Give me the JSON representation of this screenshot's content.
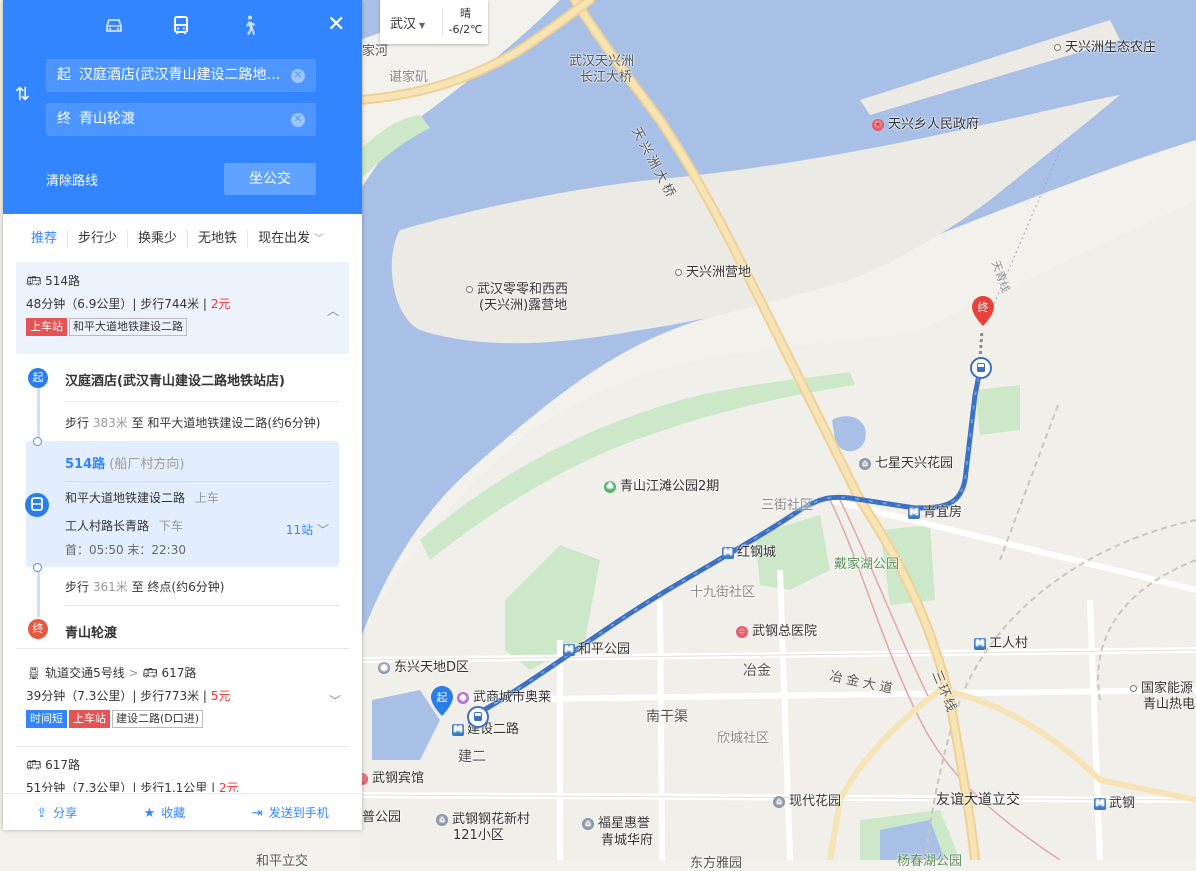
{
  "map": {
    "labels": {
      "jiahe": "家河",
      "chenjiaji": "谌家矶",
      "bridge1_l1": "武汉天兴洲",
      "bridge1_l2": "长江大桥",
      "txz_ecofarm": "天兴洲生态农庄",
      "txz_gov": "天兴乡人民政府",
      "txz_bridge": "天兴洲大桥",
      "camp1_l1": "武汉零零和西西",
      "camp1_l2": "(天兴洲)露营地",
      "txz_camp": "天兴洲营地",
      "ferry_line": "天青线",
      "qixing": "七星天兴花园",
      "qingshan_park": "青山江滩公园2期",
      "sanjieshe": "三街社区",
      "qingyifang": "青宜房",
      "hongganggcheng": "红钢城",
      "daijiahu": "戴家湖公园",
      "shijiujie": "十九街社区",
      "wugang_hosp": "武钢总医院",
      "heping_park": "和平公园",
      "gongrencun": "工人村",
      "dongxing": "东兴天地D区",
      "yejin": "冶金",
      "yejin_rd": "冶金大道",
      "ring3": "三环线",
      "outlets": "武商城市奥莱",
      "jianshe2rd": "建设二路",
      "jian2": "建二",
      "nanganqu": "南干渠",
      "xincheng": "欣城社区",
      "guojia1": "国家能源",
      "guojia2": "青山热电",
      "wugang_hotel": "武钢宾馆",
      "puyuan": "普公园",
      "wugang_hx1": "武钢钢花新村",
      "wugang_hx2": "121小区",
      "fuxing1": "福星惠誉",
      "fuxing2": "青城华府",
      "xiandai": "现代花园",
      "youyi": "友谊大道立交",
      "wugang_st": "武钢",
      "hepinglijiao": "和平立交",
      "donghuan": "东方雅园",
      "yangchun": "杨春湖公园"
    },
    "start_marker": "起",
    "end_marker": "终"
  },
  "weather": {
    "city": "武汉",
    "condition": "晴",
    "temp": "-6/2℃"
  },
  "panel": {
    "modes": [
      "car-icon",
      "bus-icon",
      "walk-icon"
    ],
    "close": "✕",
    "start_tag": "起",
    "start_value": "汉庭酒店(武汉青山建设二路地铁站店)",
    "end_tag": "终",
    "end_value": "青山轮渡",
    "clear": "清除路线",
    "search_button": "坐公交",
    "tabs": [
      "推荐",
      "步行少",
      "换乘少",
      "无地铁",
      "现在出发"
    ],
    "route1": {
      "name": "514路",
      "duration": "48分钟（6.9公里）| 步行744米 |",
      "price": "2元",
      "board_tag": "上车站",
      "board_stop": "和平大道地铁建设二路"
    },
    "steps": {
      "start_name": "汉庭酒店(武汉青山建设二路地铁站店)",
      "walk1_pre": "步行",
      "walk1_dist": "383米",
      "walk1_post": "至 和平大道地铁建设二路(约6分钟)",
      "bus_line": "514路",
      "bus_dir": "(船厂村方向)",
      "board_stop": "和平大道地铁建设二路",
      "board_label": "上车",
      "alight_stop": "工人村路长青路",
      "alight_label": "下车",
      "times": "首：05:50  末：22:30",
      "stops": "11站",
      "walk2_pre": "步行",
      "walk2_dist": "361米",
      "walk2_post": "至 终点(约6分钟)",
      "end_name": "青山轮渡"
    },
    "route2": {
      "line1": "轨道交通5号线",
      "line2": "617路",
      "duration": "39分钟（7.3公里）| 步行773米 |",
      "price": "5元",
      "tag_fast": "时间短",
      "board_tag": "上车站",
      "board_stop": "建设二路(D口进)"
    },
    "route3": {
      "name": "617路",
      "duration": "51分钟（7.3公里）| 步行1.1公里 |",
      "price": "2元"
    },
    "bottom": {
      "share": "分享",
      "fav": "收藏",
      "send": "发送到手机"
    }
  }
}
